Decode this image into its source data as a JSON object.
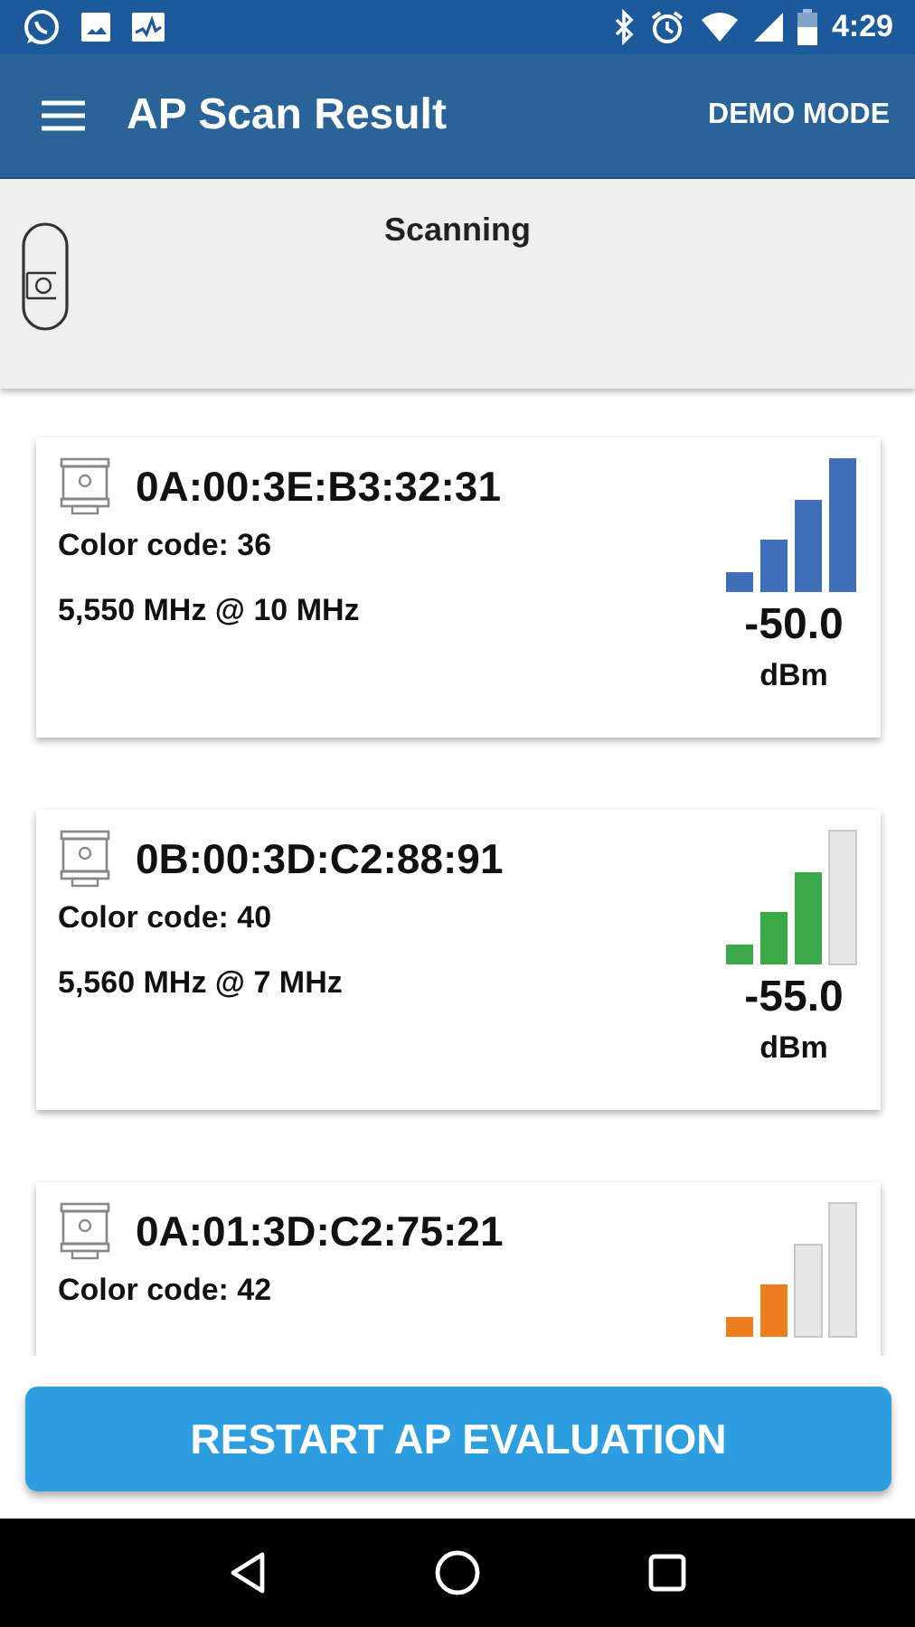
{
  "status_bar": {
    "time": "4:29"
  },
  "app_bar": {
    "title": "AP Scan Result",
    "action": "DEMO MODE"
  },
  "scan_panel": {
    "label": "Scanning"
  },
  "access_points": [
    {
      "mac": "0A:00:3E:B3:32:31",
      "color_code": "Color code: 36",
      "frequency": "5,550 MHz @ 10 MHz",
      "reading": "-50.0",
      "unit": "dBm",
      "level": 1.0,
      "color": "#3f6fba"
    },
    {
      "mac": "0B:00:3D:C2:88:91",
      "color_code": "Color code: 40",
      "frequency": "5,560 MHz @ 7 MHz",
      "reading": "-55.0",
      "unit": "dBm",
      "level": 0.75,
      "color": "#3aaa46"
    },
    {
      "mac": "0A:01:3D:C2:75:21",
      "color_code": "Color code: 42",
      "level": 0.5,
      "color": "#ee7d1d"
    }
  ],
  "button": {
    "label": "RESTART AP EVALUATION"
  }
}
